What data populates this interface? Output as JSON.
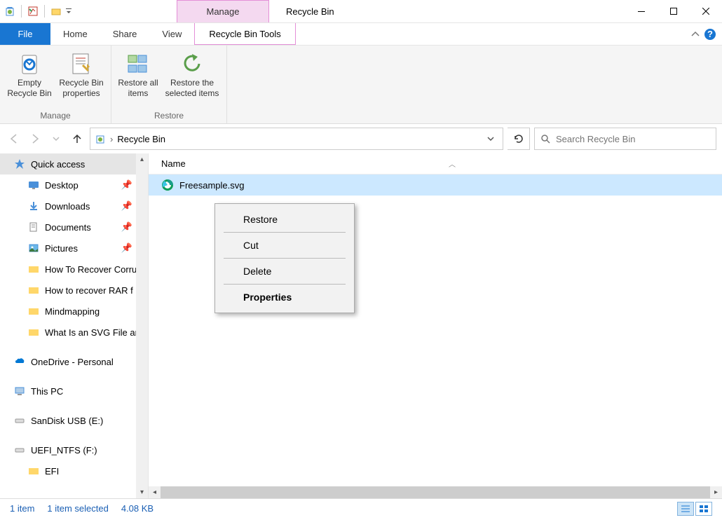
{
  "title": "Recycle Bin",
  "manage_tab": "Manage",
  "menus": {
    "file": "File",
    "home": "Home",
    "share": "Share",
    "view": "View",
    "rbt": "Recycle Bin Tools"
  },
  "ribbon": {
    "manage_group": "Manage",
    "restore_group": "Restore",
    "empty": "Empty Recycle Bin",
    "props": "Recycle Bin properties",
    "restore_all": "Restore all items",
    "restore_sel": "Restore the selected items"
  },
  "breadcrumb": {
    "location": "Recycle Bin"
  },
  "search": {
    "placeholder": "Search Recycle Bin"
  },
  "sidebar": {
    "quick": "Quick access",
    "desktop": "Desktop",
    "downloads": "Downloads",
    "documents": "Documents",
    "pictures": "Pictures",
    "f1": "How To Recover Corru",
    "f2": "How to recover RAR f",
    "f3": "Mindmapping",
    "f4": "What Is an SVG File an",
    "onedrive": "OneDrive - Personal",
    "thispc": "This PC",
    "sandisk": "SanDisk USB (E:)",
    "uefi": "UEFI_NTFS (F:)",
    "efi": "EFI"
  },
  "columns": {
    "name": "Name"
  },
  "files": [
    {
      "name": "Freesample.svg"
    }
  ],
  "context": {
    "restore": "Restore",
    "cut": "Cut",
    "delete": "Delete",
    "properties": "Properties"
  },
  "status": {
    "count": "1 item",
    "selected": "1 item selected",
    "size": "4.08 KB"
  }
}
